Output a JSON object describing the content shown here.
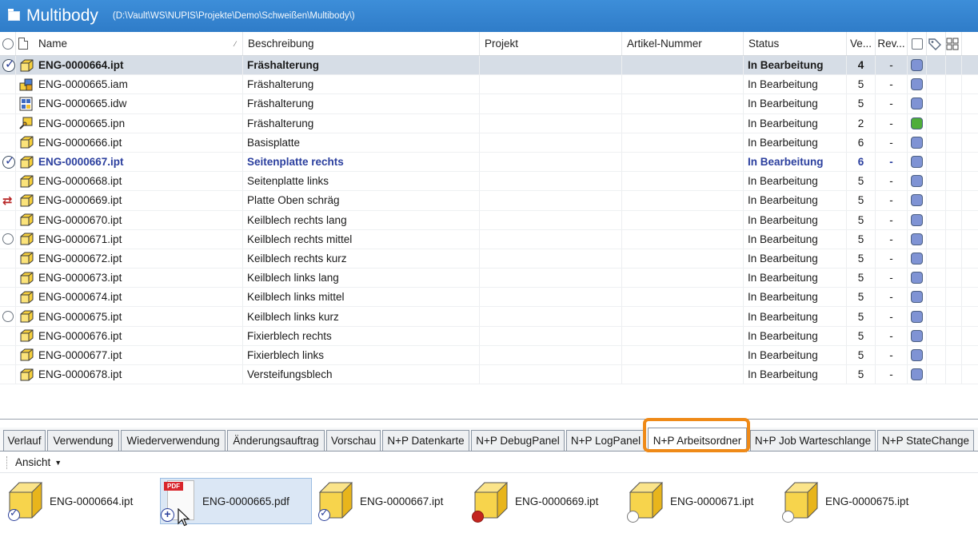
{
  "window": {
    "title": "Multibody",
    "path": "(D:\\Vault\\WS\\NUPIS\\Projekte\\Demo\\Schweißen\\Multibody\\)"
  },
  "columns": {
    "name": "Name",
    "description": "Beschreibung",
    "project": "Projekt",
    "article": "Artikel-Nummer",
    "status": "Status",
    "version": "Ve...",
    "revision": "Rev..."
  },
  "rows": [
    {
      "name": "ENG-0000664.ipt",
      "desc": "Fräshalterung",
      "status": "In Bearbeitung",
      "ver": "4",
      "rev": "-",
      "state": "checked",
      "type": "ipt",
      "color": "#7f93d4",
      "style": "sel"
    },
    {
      "name": "ENG-0000665.iam",
      "desc": "Fräshalterung",
      "status": "In Bearbeitung",
      "ver": "5",
      "rev": "-",
      "state": "none",
      "type": "iam",
      "color": "#7f93d4",
      "style": ""
    },
    {
      "name": "ENG-0000665.idw",
      "desc": "Fräshalterung",
      "status": "In Bearbeitung",
      "ver": "5",
      "rev": "-",
      "state": "none",
      "type": "idw",
      "color": "#7f93d4",
      "style": ""
    },
    {
      "name": "ENG-0000665.ipn",
      "desc": "Fräshalterung",
      "status": "In Bearbeitung",
      "ver": "2",
      "rev": "-",
      "state": "none",
      "type": "ipn",
      "color": "#4fae3a",
      "style": ""
    },
    {
      "name": "ENG-0000666.ipt",
      "desc": "Basisplatte",
      "status": "In Bearbeitung",
      "ver": "6",
      "rev": "-",
      "state": "none",
      "type": "ipt",
      "color": "#7f93d4",
      "style": ""
    },
    {
      "name": "ENG-0000667.ipt",
      "desc": "Seitenplatte rechts",
      "status": "In Bearbeitung",
      "ver": "6",
      "rev": "-",
      "state": "checked",
      "type": "ipt",
      "color": "#7f93d4",
      "style": "bold"
    },
    {
      "name": "ENG-0000668.ipt",
      "desc": "Seitenplatte links",
      "status": "In Bearbeitung",
      "ver": "5",
      "rev": "-",
      "state": "none",
      "type": "ipt",
      "color": "#7f93d4",
      "style": ""
    },
    {
      "name": "ENG-0000669.ipt",
      "desc": "Platte Oben schräg",
      "status": "In Bearbeitung",
      "ver": "5",
      "rev": "-",
      "state": "sync",
      "type": "ipt",
      "color": "#7f93d4",
      "style": ""
    },
    {
      "name": "ENG-0000670.ipt",
      "desc": "Keilblech rechts lang",
      "status": "In Bearbeitung",
      "ver": "5",
      "rev": "-",
      "state": "none",
      "type": "ipt",
      "color": "#7f93d4",
      "style": ""
    },
    {
      "name": "ENG-0000671.ipt",
      "desc": "Keilblech rechts mittel",
      "status": "In Bearbeitung",
      "ver": "5",
      "rev": "-",
      "state": "radio",
      "type": "ipt",
      "color": "#7f93d4",
      "style": ""
    },
    {
      "name": "ENG-0000672.ipt",
      "desc": "Keilblech rechts kurz",
      "status": "In Bearbeitung",
      "ver": "5",
      "rev": "-",
      "state": "none",
      "type": "ipt",
      "color": "#7f93d4",
      "style": ""
    },
    {
      "name": "ENG-0000673.ipt",
      "desc": "Keilblech links lang",
      "status": "In Bearbeitung",
      "ver": "5",
      "rev": "-",
      "state": "none",
      "type": "ipt",
      "color": "#7f93d4",
      "style": ""
    },
    {
      "name": "ENG-0000674.ipt",
      "desc": "Keilblech links mittel",
      "status": "In Bearbeitung",
      "ver": "5",
      "rev": "-",
      "state": "none",
      "type": "ipt",
      "color": "#7f93d4",
      "style": ""
    },
    {
      "name": "ENG-0000675.ipt",
      "desc": "Keilblech links kurz",
      "status": "In Bearbeitung",
      "ver": "5",
      "rev": "-",
      "state": "radio",
      "type": "ipt",
      "color": "#7f93d4",
      "style": ""
    },
    {
      "name": "ENG-0000676.ipt",
      "desc": "Fixierblech rechts",
      "status": "In Bearbeitung",
      "ver": "5",
      "rev": "-",
      "state": "none",
      "type": "ipt",
      "color": "#7f93d4",
      "style": ""
    },
    {
      "name": "ENG-0000677.ipt",
      "desc": "Fixierblech links",
      "status": "In Bearbeitung",
      "ver": "5",
      "rev": "-",
      "state": "none",
      "type": "ipt",
      "color": "#7f93d4",
      "style": ""
    },
    {
      "name": "ENG-0000678.ipt",
      "desc": "Versteifungsblech",
      "status": "In Bearbeitung",
      "ver": "5",
      "rev": "-",
      "state": "none",
      "type": "ipt",
      "color": "#7f93d4",
      "style": ""
    }
  ],
  "tabs": [
    {
      "label": "Verlauf",
      "active": false
    },
    {
      "label": "Verwendung",
      "active": false
    },
    {
      "label": "Wiederverwendung",
      "active": false
    },
    {
      "label": "Änderungsauftrag",
      "active": false
    },
    {
      "label": "Vorschau",
      "active": false
    },
    {
      "label": "N+P Datenkarte",
      "active": false
    },
    {
      "label": "N+P DebugPanel",
      "active": false
    },
    {
      "label": "N+P LogPanel",
      "active": false
    },
    {
      "label": "N+P Arbeitsordner",
      "active": true
    },
    {
      "label": "N+P Job Warteschlange",
      "active": false
    },
    {
      "label": "N+P StateChange",
      "active": false
    }
  ],
  "toolbar": {
    "view_label": "Ansicht"
  },
  "files": [
    {
      "name": "ENG-0000664.ipt",
      "badge": "check",
      "kind": "cube"
    },
    {
      "name": "ENG-0000665.pdf",
      "badge": "plus",
      "kind": "pdf",
      "pdf_tag": "PDF"
    },
    {
      "name": "ENG-0000667.ipt",
      "badge": "check",
      "kind": "cube"
    },
    {
      "name": "ENG-0000669.ipt",
      "badge": "red",
      "kind": "cube"
    },
    {
      "name": "ENG-0000671.ipt",
      "badge": "empty",
      "kind": "cube"
    },
    {
      "name": "ENG-0000675.ipt",
      "badge": "empty",
      "kind": "cube"
    }
  ],
  "colors": {
    "accent": "#ef8a18",
    "titlebar": "#3d8ed9",
    "selection": "#d6dde6"
  }
}
